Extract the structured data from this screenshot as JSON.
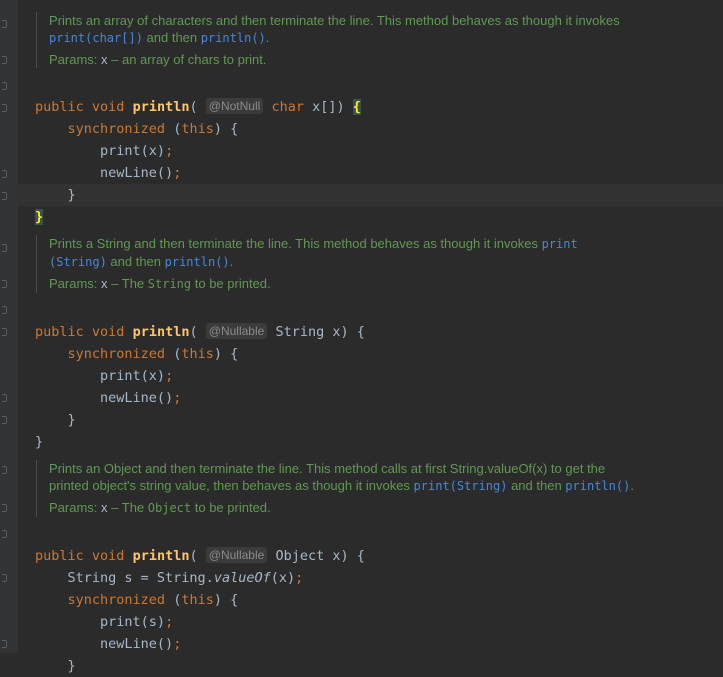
{
  "docs": [
    {
      "desc_1": "Prints an array of characters and then terminate the line. This method behaves as though it invokes",
      "ref_1": "print(char[])",
      "mid_1": " and then ",
      "ref_2": "println()",
      "end_1": ".",
      "params_label": "Params:",
      "param_name": "x",
      "param_desc": " – an array of chars to print."
    },
    {
      "desc_1": "Prints a String and then terminate the line. This method behaves as though it invokes ",
      "ref_1a": "print",
      "ref_1b": "(String)",
      "mid_1": " and then ",
      "ref_2": "println()",
      "end_1": ".",
      "params_label": "Params:",
      "param_name": "x",
      "param_desc_a": " – The ",
      "param_desc_code": "String",
      "param_desc_b": " to be printed."
    },
    {
      "desc_1": "Prints an Object and then terminate the line. This method calls at first String.valueOf(x) to get the",
      "desc_2": "printed object's string value, then behaves as though it invokes ",
      "ref_1": "print(String)",
      "mid_1": " and then ",
      "ref_2": "println()",
      "end_1": ".",
      "params_label": "Params:",
      "param_name": "x",
      "param_desc_a": " – The ",
      "param_desc_code": "Object",
      "param_desc_b": " to be printed."
    }
  ],
  "code": {
    "kw_public": "public",
    "kw_void": "void",
    "method": "println",
    "paren_open": "(",
    "ann_notnull": "@NotNull",
    "ann_nullable": "@Nullable",
    "kw_char": "char",
    "param1": " x[]) ",
    "param2": "String x) {",
    "param3": "Object x) {",
    "brace_open": "{",
    "brace_close": "}",
    "kw_synchronized": "synchronized",
    "this_expr": "(this) {",
    "this_open": "(",
    "kw_this": "this",
    "this_close": ") {",
    "print_x": "print(x)",
    "print_s": "print(s)",
    "newline": "newLine()",
    "semicolon": ";",
    "string_s_a": "String s = String.",
    "value_of": "valueOf",
    "string_s_b": "(x)"
  }
}
